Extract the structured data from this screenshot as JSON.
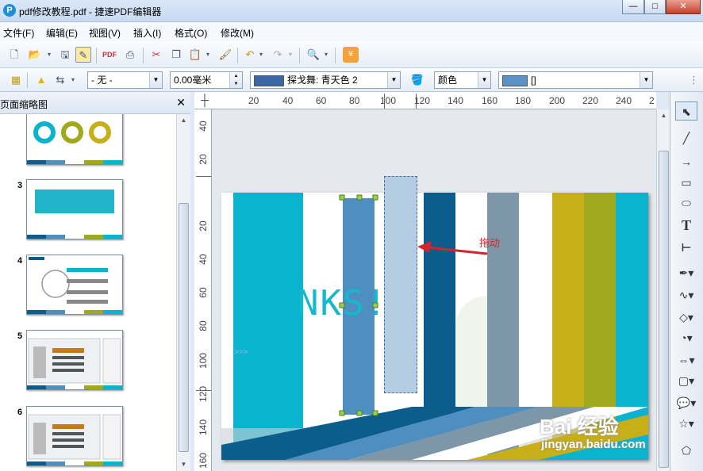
{
  "window": {
    "title": "pdf修改教程.pdf - 捷速PDF编辑器",
    "app_icon": "P",
    "minimize": "—",
    "maximize": "□",
    "close": "✕"
  },
  "menu": [
    "文件(F)",
    "编辑(E)",
    "视图(V)",
    "插入(I)",
    "格式(O)",
    "修改(M)"
  ],
  "toolbar2": {
    "line_style": "- 无 -",
    "line_width": "0.00毫米",
    "fill_color_name": "探戈舞: 青天色 2",
    "fill_color_hex": "#3b67a6",
    "color_label": "颜色",
    "line_color_value": "[]",
    "line_color_hex": "#5b92c6"
  },
  "sidebar": {
    "title": "页面缩略图",
    "close": "✕",
    "thumb_numbers": [
      "3",
      "4",
      "5",
      "6"
    ]
  },
  "ruler": {
    "h_labels": [
      "20",
      "40",
      "60",
      "80",
      "100",
      "120",
      "140",
      "160",
      "180",
      "200",
      "220",
      "240",
      "2"
    ],
    "v_labels": [
      "40",
      "20",
      "20",
      "40",
      "60",
      "80",
      "100",
      "120",
      "140",
      "160"
    ]
  },
  "page": {
    "thanks_text": "NKS!",
    "arrow_label": "拖动",
    "edge_marks": ">>>"
  },
  "colors": {
    "cyan": "#0ab4cf",
    "steel": "#4f8fc0",
    "navy": "#0b5e8c",
    "slate": "#7d97a8",
    "olive": "#c8ae18",
    "green": "#a0a81c",
    "selected": "#b5cde3",
    "arrow": "#d4252c"
  },
  "watermark": {
    "logo": "Bai 经验",
    "url": "jingyan.baidu.com"
  },
  "icons": [
    "new-icon",
    "open-icon",
    "save-icon",
    "edit-icon",
    "export-pdf-icon",
    "print-icon",
    "cut-icon",
    "copy-icon",
    "paste-icon",
    "format-painter-icon",
    "undo-icon",
    "redo-icon",
    "zoom-icon",
    "coupon-icon",
    "select-icon",
    "line-icon",
    "arrow-icon",
    "rectangle-icon",
    "ellipse-icon",
    "text-icon",
    "bracket-icon",
    "pen-icon",
    "curve-icon",
    "diamond-icon",
    "sphere-icon",
    "double-arrow-icon",
    "box-icon",
    "callout-icon",
    "star-icon",
    "polygon-icon"
  ]
}
